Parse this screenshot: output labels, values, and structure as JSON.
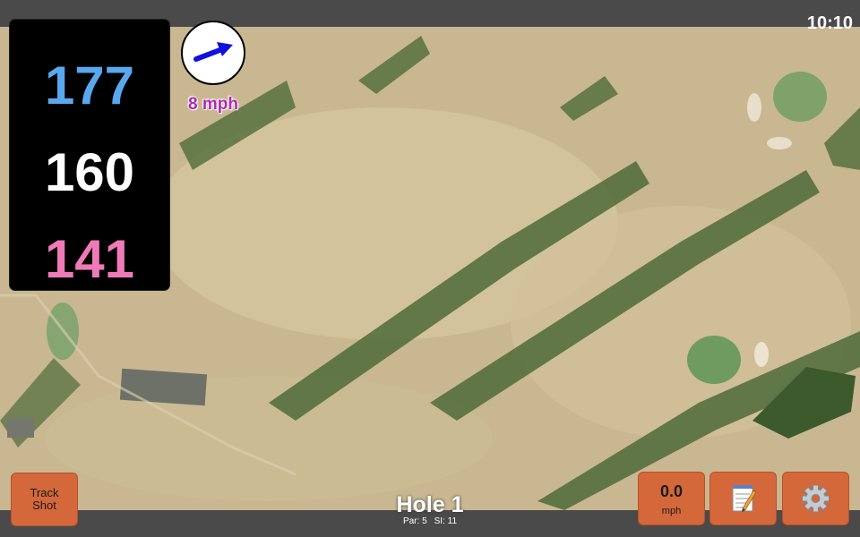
{
  "status_bar": {
    "time": "10:10"
  },
  "yardages": {
    "back": "177",
    "middle": "160",
    "front": "141"
  },
  "wind": {
    "speed_label": "8 mph",
    "direction_icon": "wind-arrow-icon"
  },
  "hole": {
    "title": "Hole 1",
    "par": "Par: 5",
    "stroke_index": "SI: 11"
  },
  "buttons": {
    "track_shot_line1": "Track",
    "track_shot_line2": "Shot",
    "speed_value": "0.0",
    "speed_unit": "mph",
    "notes_icon": "notepad-icon",
    "settings_icon": "gear-icon"
  },
  "colors": {
    "back_yardage": "#5aa7ee",
    "middle_yardage": "#ffffff",
    "front_yardage": "#f07ab8",
    "button_accent": "#d4683a",
    "wind_label": "#b02ab0"
  }
}
